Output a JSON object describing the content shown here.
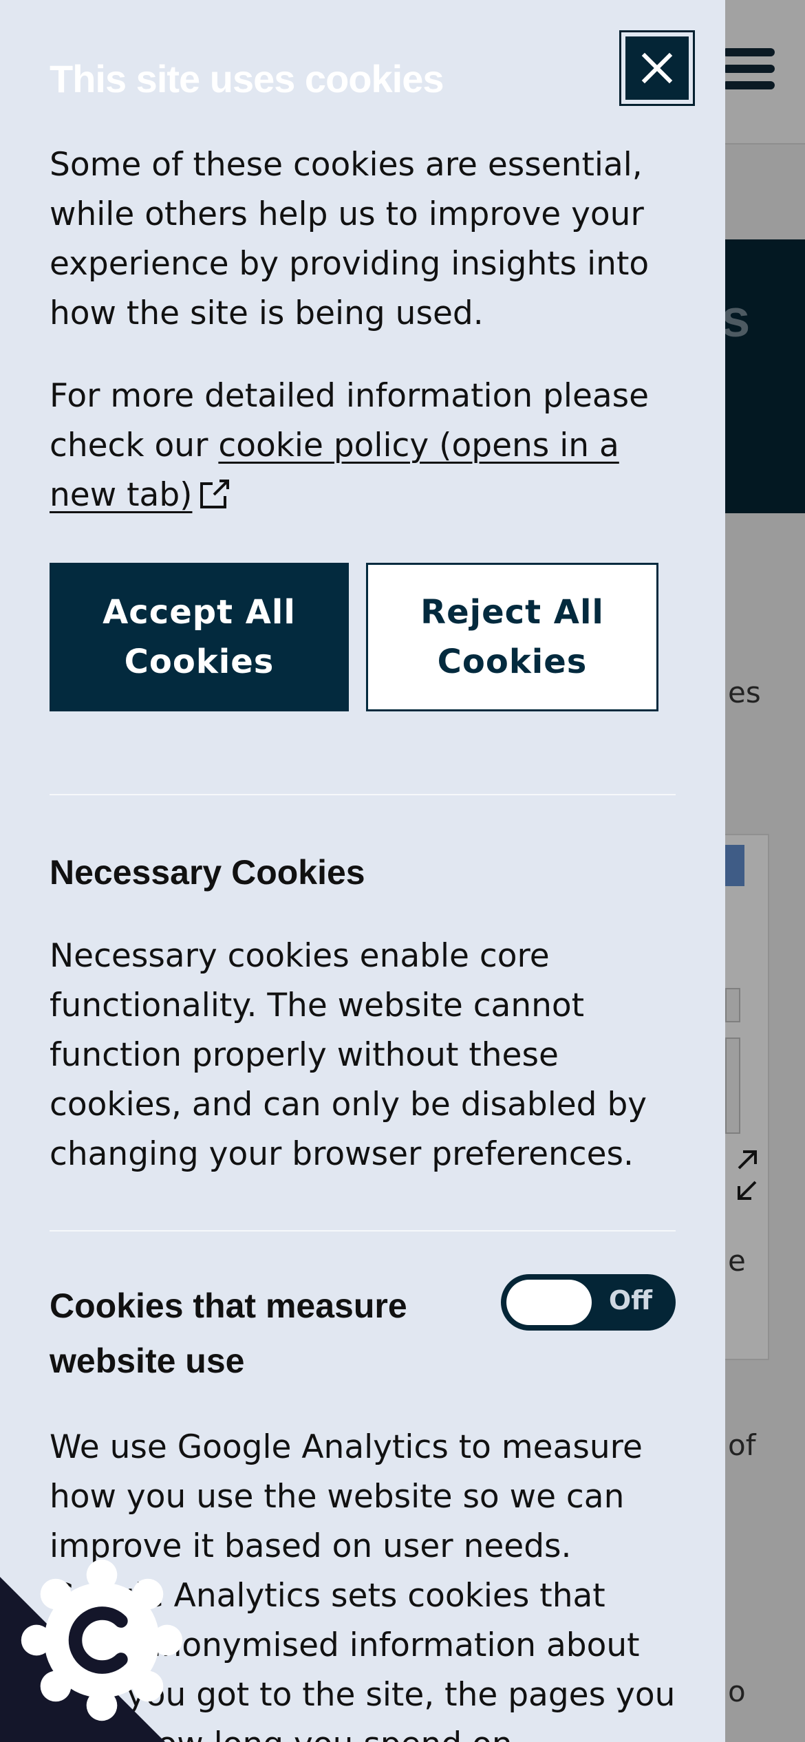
{
  "panel": {
    "title": "This site uses cookies",
    "close_label": "Close",
    "intro": "Some of these cookies are essential, while others help us to improve your experience by providing insights into how the site is being used.",
    "more_info_prefix": "For more detailed information please check our ",
    "policy_link": "cookie policy (opens in a new tab)",
    "accept_label": "Accept All Cookies",
    "reject_label": "Reject All Cookies"
  },
  "necessary": {
    "title": "Necessary Cookies",
    "description": "Necessary cookies enable core functionality. The website cannot function properly without these cookies, and can only be disabled by changing your browser preferences."
  },
  "analytics": {
    "title": "Cookies that measure website use",
    "toggle_state": "Off",
    "description": "We use Google Analytics to measure how you use the website so we can improve it based on user needs. Google Analytics sets cookies that store anonymised information about how you got to the site, the pages you visit, how long you spend on"
  },
  "background": {
    "hero_fragment": "s",
    "text_fragments": [
      "es",
      "e",
      "of",
      "o"
    ]
  },
  "colors": {
    "panel_bg": "#e1e7f1",
    "primary": "#032a3e",
    "overlay": "#9b9b9b",
    "hero": "#031822"
  },
  "icons": {
    "close": "close-icon",
    "external": "external-link-icon",
    "cookie": "cookie-icon",
    "expand": "expand-arrows-icon",
    "menu": "hamburger-menu-icon"
  }
}
